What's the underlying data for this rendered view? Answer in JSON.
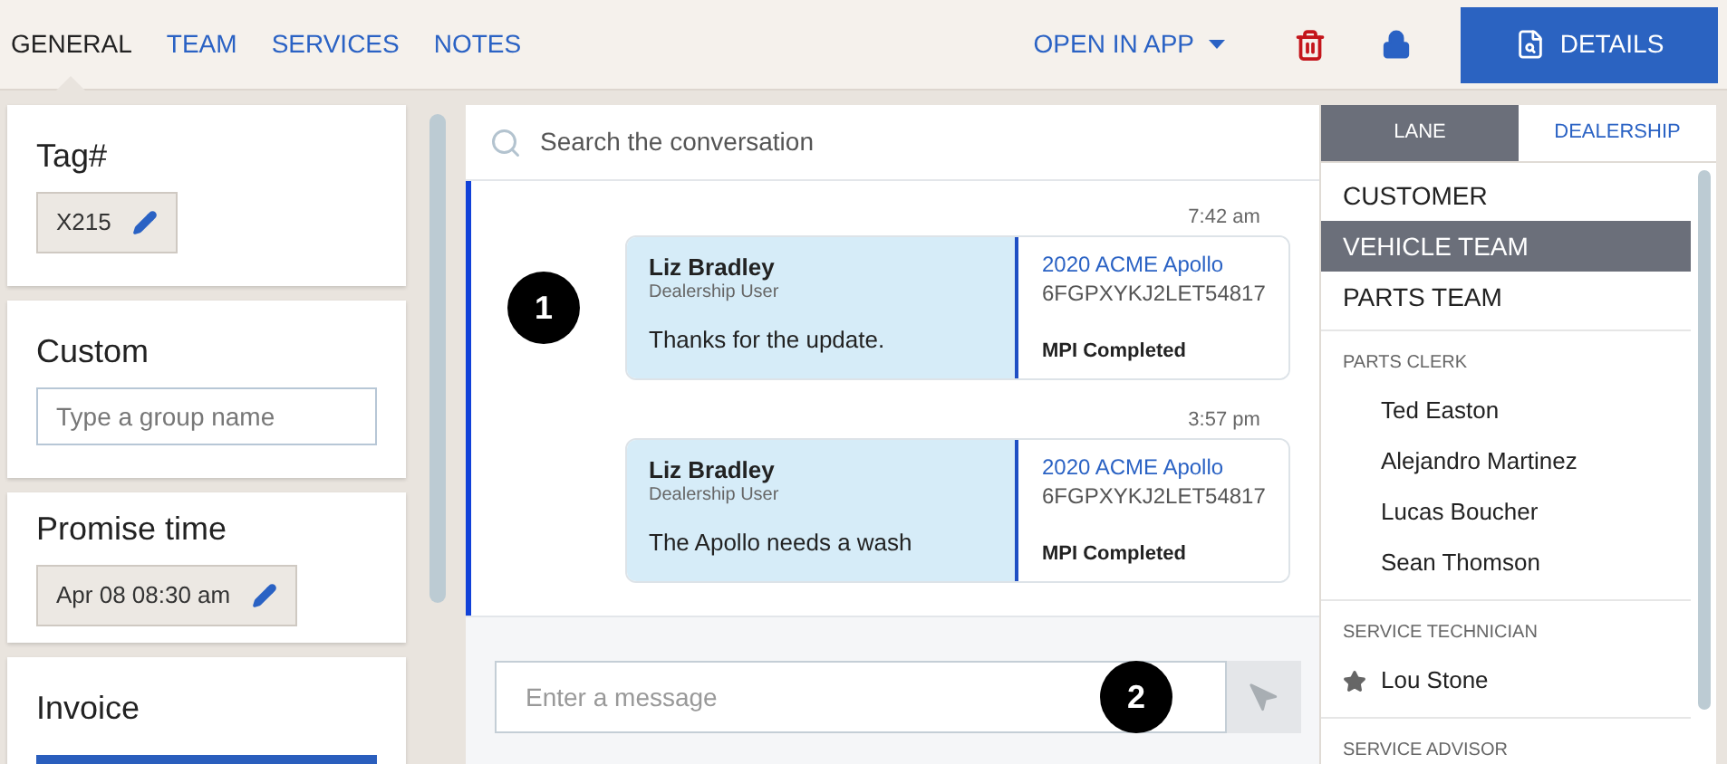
{
  "tabs": [
    {
      "label": "GENERAL",
      "selected": true
    },
    {
      "label": "TEAM",
      "selected": false
    },
    {
      "label": "SERVICES",
      "selected": false
    },
    {
      "label": "NOTES",
      "selected": false
    }
  ],
  "open_in_app": "OPEN IN APP",
  "details_button": "DETAILS",
  "cards": [
    {
      "kind": "chip",
      "title": "Tag#",
      "value": "X215"
    },
    {
      "kind": "input",
      "title": "Custom",
      "placeholder": "Type a group name"
    },
    {
      "kind": "chip",
      "title": "Promise time",
      "value": "Apr 08 08:30 am"
    },
    {
      "kind": "bar",
      "title": "Invoice"
    }
  ],
  "chat": {
    "search_placeholder": "Search the conversation",
    "messages": [
      {
        "time": "7:42 am",
        "sender": "Liz Bradley",
        "role": "Dealership User",
        "text": "Thanks for the update.",
        "vehicle": "2020 ACME Apollo",
        "vin": "6FGPXYKJ2LET54817",
        "status": "MPI Completed",
        "callout": "1"
      },
      {
        "time": "3:57 pm",
        "sender": "Liz Bradley",
        "role": "Dealership User",
        "text": "The Apollo needs a wash",
        "vehicle": "2020 ACME Apollo",
        "vin": "6FGPXYKJ2LET54817",
        "status": "MPI Completed"
      }
    ],
    "composer_placeholder": "Enter a message",
    "composer_callout": "2"
  },
  "team_panel": {
    "tabs": [
      {
        "label": "LANE",
        "selected": true
      },
      {
        "label": "DEALERSHIP",
        "selected": false
      }
    ],
    "teams": [
      {
        "label": "CUSTOMER",
        "selected": false
      },
      {
        "label": "VEHICLE TEAM",
        "selected": true
      },
      {
        "label": "PARTS TEAM",
        "selected": false
      }
    ],
    "groups": [
      {
        "heading": "PARTS CLERK",
        "members": [
          {
            "name": "Ted Easton",
            "starred": false
          },
          {
            "name": "Alejandro Martinez",
            "starred": false
          },
          {
            "name": "Lucas Boucher",
            "starred": false
          },
          {
            "name": "Sean Thomson",
            "starred": false
          }
        ]
      },
      {
        "heading": "SERVICE TECHNICIAN",
        "members": [
          {
            "name": "Lou Stone",
            "starred": true
          }
        ]
      },
      {
        "heading": "SERVICE ADVISOR"
      }
    ]
  }
}
